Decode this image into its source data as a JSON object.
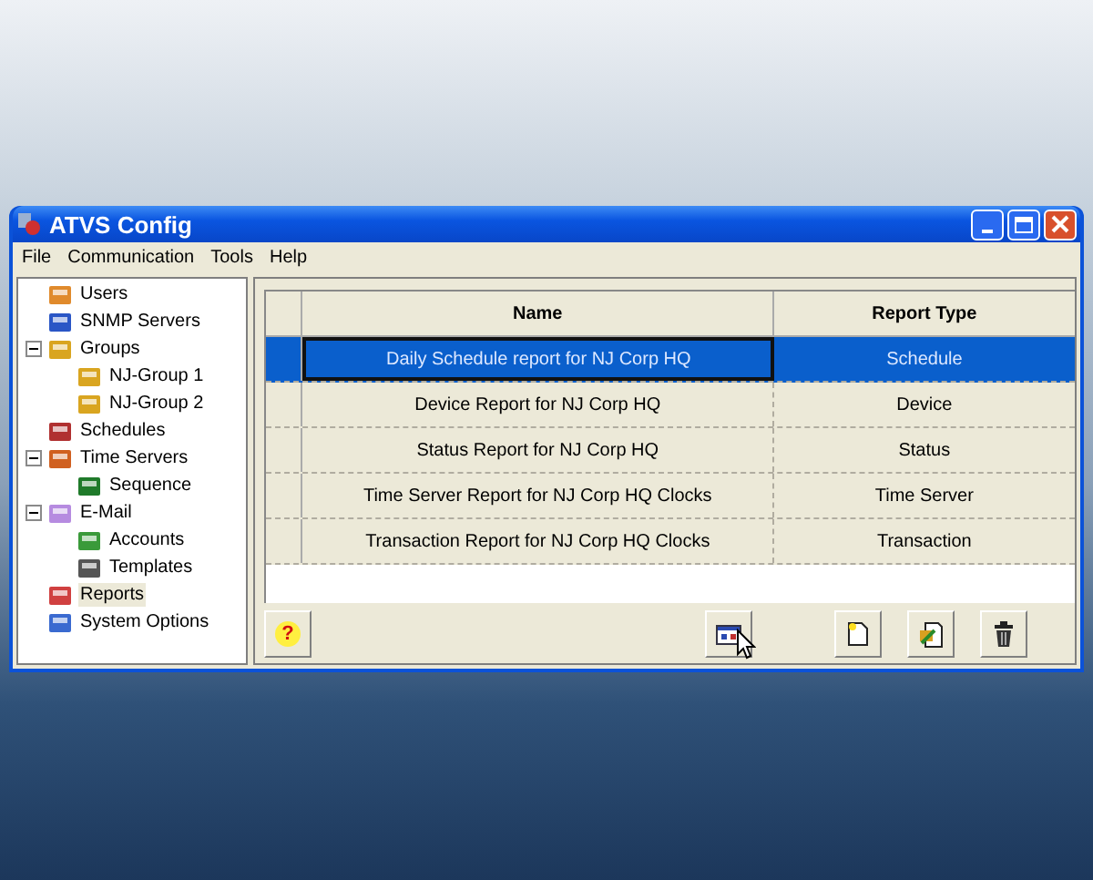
{
  "window": {
    "title": "ATVS Config"
  },
  "menu": [
    "File",
    "Communication",
    "Tools",
    "Help"
  ],
  "tree": [
    {
      "label": "Users",
      "selected": false
    },
    {
      "label": "SNMP Servers",
      "selected": false
    },
    {
      "label": "Groups",
      "selected": false,
      "expanded": true,
      "children": [
        {
          "label": "NJ-Group 1",
          "selected": false
        },
        {
          "label": "NJ-Group 2",
          "selected": false
        }
      ]
    },
    {
      "label": "Schedules",
      "selected": false
    },
    {
      "label": "Time Servers",
      "selected": false,
      "expanded": true,
      "children": [
        {
          "label": "Sequence",
          "selected": false
        }
      ]
    },
    {
      "label": "E-Mail",
      "selected": false,
      "expanded": true,
      "children": [
        {
          "label": "Accounts",
          "selected": false
        },
        {
          "label": "Templates",
          "selected": false
        }
      ]
    },
    {
      "label": "Reports",
      "selected": true
    },
    {
      "label": "System Options",
      "selected": false
    }
  ],
  "table": {
    "columns": [
      "Name",
      "Report Type"
    ],
    "rows": [
      {
        "name": "Daily Schedule report for NJ Corp HQ",
        "type": "Schedule",
        "selected": true
      },
      {
        "name": "Device Report for NJ Corp HQ",
        "type": "Device",
        "selected": false
      },
      {
        "name": "Status Report for NJ Corp HQ",
        "type": "Status",
        "selected": false
      },
      {
        "name": "Time Server Report for NJ Corp HQ Clocks",
        "type": "Time Server",
        "selected": false
      },
      {
        "name": "Transaction Report for NJ Corp HQ Clocks",
        "type": "Transaction",
        "selected": false
      }
    ]
  },
  "help_button": {
    "label": "?"
  }
}
